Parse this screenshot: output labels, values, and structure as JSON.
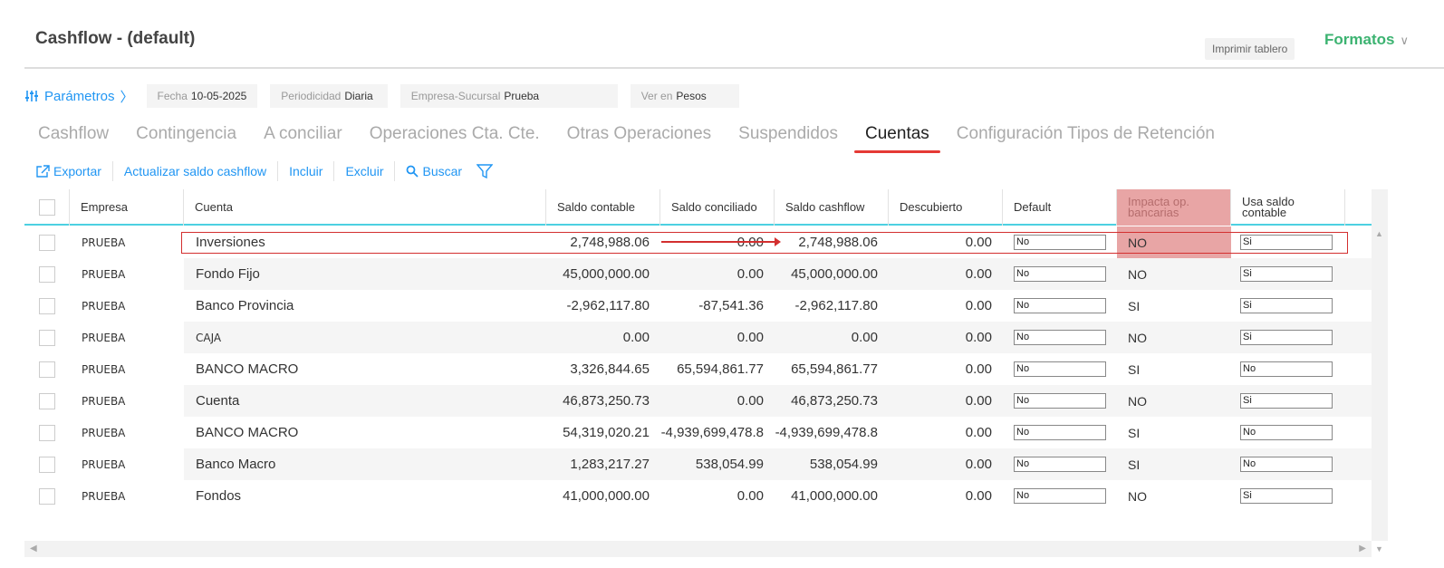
{
  "header": {
    "title": "Cashflow - (default)",
    "print_label": "Imprimir tablero",
    "formatos_label": "Formatos"
  },
  "params": {
    "link_label": "Parámetros",
    "fecha_label": "Fecha",
    "fecha_value": "10-05-2025",
    "periodicidad_label": "Periodicidad",
    "periodicidad_value": "Diaria",
    "empresa_label": "Empresa-Sucursal",
    "empresa_value": "Prueba",
    "ver_label": "Ver en",
    "ver_value": "Pesos"
  },
  "tabs": [
    {
      "label": "Cashflow"
    },
    {
      "label": "Contingencia"
    },
    {
      "label": "A conciliar"
    },
    {
      "label": "Operaciones Cta. Cte."
    },
    {
      "label": "Otras Operaciones"
    },
    {
      "label": "Suspendidos"
    },
    {
      "label": "Cuentas"
    },
    {
      "label": "Configuración Tipos de Retención"
    }
  ],
  "active_tab": "Cuentas",
  "toolbar": {
    "exportar": "Exportar",
    "actualizar": "Actualizar saldo cashflow",
    "incluir": "Incluir",
    "excluir": "Excluir",
    "buscar": "Buscar"
  },
  "columns": {
    "empresa": "Empresa",
    "cuenta": "Cuenta",
    "saldo_contable": "Saldo contable",
    "saldo_conciliado": "Saldo conciliado",
    "saldo_cashflow": "Saldo cashflow",
    "descubierto": "Descubierto",
    "default": "Default",
    "impacta": "Impacta op. bancarias",
    "usa_saldo": "Usa saldo contable"
  },
  "rows": [
    {
      "empresa": "PRUEBA",
      "cuenta": "Inversiones",
      "saldo_contable": "2,748,988.06",
      "saldo_conciliado": "0.00",
      "saldo_cashflow": "2,748,988.06",
      "descubierto": "0.00",
      "default": "No",
      "impacta": "NO",
      "usa_saldo": "Si"
    },
    {
      "empresa": "PRUEBA",
      "cuenta": "Fondo Fijo",
      "saldo_contable": "45,000,000.00",
      "saldo_conciliado": "0.00",
      "saldo_cashflow": "45,000,000.00",
      "descubierto": "0.00",
      "default": "No",
      "impacta": "NO",
      "usa_saldo": "Si"
    },
    {
      "empresa": "PRUEBA",
      "cuenta": "Banco Provincia",
      "saldo_contable": "-2,962,117.80",
      "saldo_conciliado": "-87,541.36",
      "saldo_cashflow": "-2,962,117.80",
      "descubierto": "0.00",
      "default": "No",
      "impacta": "SI",
      "usa_saldo": "Si"
    },
    {
      "empresa": "PRUEBA",
      "cuenta": "CAJA",
      "saldo_contable": "0.00",
      "saldo_conciliado": "0.00",
      "saldo_cashflow": "0.00",
      "descubierto": "0.00",
      "default": "No",
      "impacta": "NO",
      "usa_saldo": "Si"
    },
    {
      "empresa": "PRUEBA",
      "cuenta": "BANCO MACRO",
      "saldo_contable": "3,326,844.65",
      "saldo_conciliado": "65,594,861.77",
      "saldo_cashflow": "65,594,861.77",
      "descubierto": "0.00",
      "default": "No",
      "impacta": "SI",
      "usa_saldo": "No"
    },
    {
      "empresa": "PRUEBA",
      "cuenta": "Cuenta",
      "saldo_contable": "46,873,250.73",
      "saldo_conciliado": "0.00",
      "saldo_cashflow": "46,873,250.73",
      "descubierto": "0.00",
      "default": "No",
      "impacta": "NO",
      "usa_saldo": "Si"
    },
    {
      "empresa": "PRUEBA",
      "cuenta": "BANCO MACRO",
      "saldo_contable": "54,319,020.21",
      "saldo_conciliado": "-4,939,699,478.8",
      "saldo_cashflow": "-4,939,699,478.8",
      "descubierto": "0.00",
      "default": "No",
      "impacta": "SI",
      "usa_saldo": "No"
    },
    {
      "empresa": "PRUEBA",
      "cuenta": "Banco Macro",
      "saldo_contable": "1,283,217.27",
      "saldo_conciliado": "538,054.99",
      "saldo_cashflow": "538,054.99",
      "descubierto": "0.00",
      "default": "No",
      "impacta": "SI",
      "usa_saldo": "No"
    },
    {
      "empresa": "PRUEBA",
      "cuenta": "Fondos",
      "saldo_contable": "41,000,000.00",
      "saldo_conciliado": "0.00",
      "saldo_cashflow": "41,000,000.00",
      "descubierto": "0.00",
      "default": "No",
      "impacta": "NO",
      "usa_saldo": "Si"
    }
  ],
  "colors": {
    "accent": "#2196f3",
    "brand_green": "#3cb371",
    "active_tab_underline": "#e53935",
    "highlight_column": "#e8a5a5",
    "annotation_red": "#d32f2f"
  }
}
